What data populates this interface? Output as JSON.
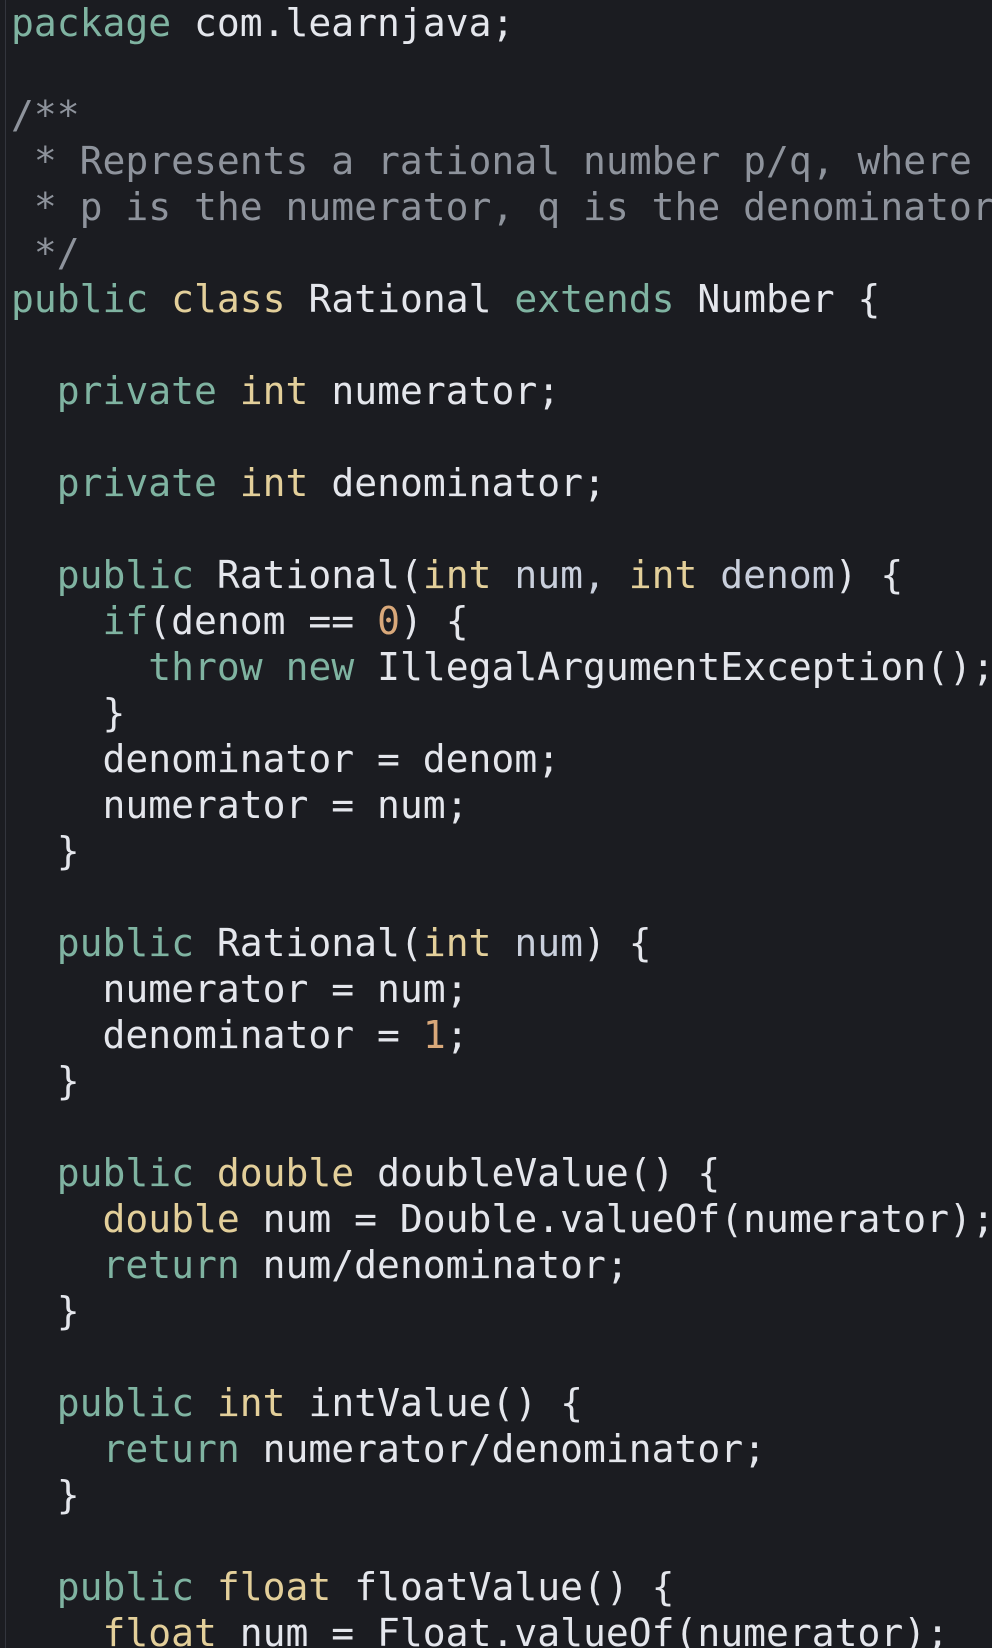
{
  "colors": {
    "background": "#1b1c21",
    "keyword": "#7fb3a1",
    "type": "#e3cf9a",
    "number": "#d9a87a",
    "comment": "#8e939c",
    "identifier": "#e4e6ec",
    "variable": "#c9cfdc"
  },
  "lines": [
    [
      {
        "t": "kw",
        "v": "package"
      },
      {
        "t": "id",
        "v": " com.learnjava;"
      }
    ],
    [],
    [
      {
        "t": "cm",
        "v": "/**"
      }
    ],
    [
      {
        "t": "cm",
        "v": " * Represents a rational number p/q, where"
      }
    ],
    [
      {
        "t": "cm",
        "v": " * p is the numerator, q is the denominator"
      }
    ],
    [
      {
        "t": "cm",
        "v": " */"
      }
    ],
    [
      {
        "t": "kw",
        "v": "public"
      },
      {
        "t": "id",
        "v": " "
      },
      {
        "t": "ty",
        "v": "class"
      },
      {
        "t": "id",
        "v": " Rational "
      },
      {
        "t": "kw",
        "v": "extends"
      },
      {
        "t": "id",
        "v": " Number {"
      }
    ],
    [],
    [
      {
        "t": "kw",
        "v": "  private"
      },
      {
        "t": "id",
        "v": " "
      },
      {
        "t": "ty",
        "v": "int"
      },
      {
        "t": "id",
        "v": " numerator;"
      }
    ],
    [],
    [
      {
        "t": "kw",
        "v": "  private"
      },
      {
        "t": "id",
        "v": " "
      },
      {
        "t": "ty",
        "v": "int"
      },
      {
        "t": "id",
        "v": " denominator;"
      }
    ],
    [],
    [
      {
        "t": "kw",
        "v": "  public"
      },
      {
        "t": "id",
        "v": " Rational("
      },
      {
        "t": "ty",
        "v": "int"
      },
      {
        "t": "nm",
        "v": " num, "
      },
      {
        "t": "ty",
        "v": "int"
      },
      {
        "t": "nm",
        "v": " denom"
      },
      {
        "t": "id",
        "v": ") {"
      }
    ],
    [
      {
        "t": "kw",
        "v": "    if"
      },
      {
        "t": "id",
        "v": "(denom == "
      },
      {
        "t": "num",
        "v": "0"
      },
      {
        "t": "id",
        "v": ") {"
      }
    ],
    [
      {
        "t": "kw",
        "v": "      throw"
      },
      {
        "t": "id",
        "v": " "
      },
      {
        "t": "kw",
        "v": "new"
      },
      {
        "t": "id",
        "v": " IllegalArgumentException();"
      }
    ],
    [
      {
        "t": "id",
        "v": "    }"
      }
    ],
    [
      {
        "t": "id",
        "v": "    denominator = denom;"
      }
    ],
    [
      {
        "t": "id",
        "v": "    numerator = num;"
      }
    ],
    [
      {
        "t": "id",
        "v": "  }"
      }
    ],
    [],
    [
      {
        "t": "kw",
        "v": "  public"
      },
      {
        "t": "id",
        "v": " Rational("
      },
      {
        "t": "ty",
        "v": "int"
      },
      {
        "t": "nm",
        "v": " num"
      },
      {
        "t": "id",
        "v": ") {"
      }
    ],
    [
      {
        "t": "id",
        "v": "    numerator = num;"
      }
    ],
    [
      {
        "t": "id",
        "v": "    denominator = "
      },
      {
        "t": "num",
        "v": "1"
      },
      {
        "t": "id",
        "v": ";"
      }
    ],
    [
      {
        "t": "id",
        "v": "  }"
      }
    ],
    [],
    [
      {
        "t": "kw",
        "v": "  public"
      },
      {
        "t": "id",
        "v": " "
      },
      {
        "t": "ty",
        "v": "double"
      },
      {
        "t": "id",
        "v": " doubleValue() {"
      }
    ],
    [
      {
        "t": "ty",
        "v": "    double"
      },
      {
        "t": "id",
        "v": " num = Double.valueOf(numerator);"
      }
    ],
    [
      {
        "t": "kw",
        "v": "    return"
      },
      {
        "t": "id",
        "v": " num/denominator;"
      }
    ],
    [
      {
        "t": "id",
        "v": "  }"
      }
    ],
    [],
    [
      {
        "t": "kw",
        "v": "  public"
      },
      {
        "t": "id",
        "v": " "
      },
      {
        "t": "ty",
        "v": "int"
      },
      {
        "t": "id",
        "v": " intValue() {"
      }
    ],
    [
      {
        "t": "kw",
        "v": "    return"
      },
      {
        "t": "id",
        "v": " numerator/denominator;"
      }
    ],
    [
      {
        "t": "id",
        "v": "  }"
      }
    ],
    [],
    [
      {
        "t": "kw",
        "v": "  public"
      },
      {
        "t": "id",
        "v": " "
      },
      {
        "t": "ty",
        "v": "float"
      },
      {
        "t": "id",
        "v": " floatValue() {"
      }
    ],
    [
      {
        "t": "ty",
        "v": "    float"
      },
      {
        "t": "id",
        "v": " num = Float.valueOf(numerator);"
      }
    ]
  ]
}
